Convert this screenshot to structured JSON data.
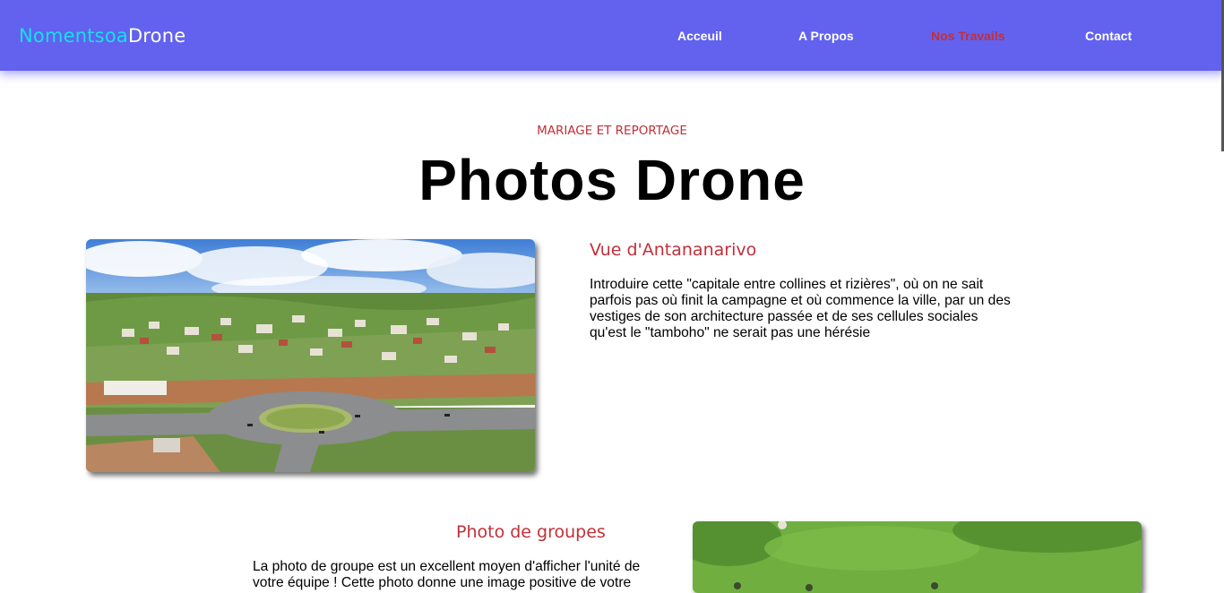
{
  "brand": {
    "part1": "Nomentsoa",
    "part2": "Drone"
  },
  "nav": {
    "items": [
      {
        "label": "Acceuil",
        "active": false
      },
      {
        "label": "A Propos",
        "active": false
      },
      {
        "label": "Nos Travails",
        "active": true
      },
      {
        "label": "Contact",
        "active": false
      }
    ]
  },
  "hero": {
    "kicker": "MARIAGE ET REPORTAGE",
    "title": "Photos Drone"
  },
  "sections": [
    {
      "title": "Vue d'Antananarivo",
      "text": "Introduire cette \"capitale entre collines et rizières\", où on ne sait parfois pas où finit la campagne et où commence la ville, par un des vestiges de son architecture passée et de ses cellules sociales qu'est le \"tamboho\" ne serait pas une hérésie"
    },
    {
      "title": "Photo de groupes",
      "text": "La photo de groupe est un excellent moyen d'afficher l'unité de votre équipe ! Cette photo donne une image positive de votre"
    }
  ],
  "colors": {
    "navbar": "#6262ef",
    "brand_accent": "#16e0e9",
    "accent_red": "#c0303a"
  }
}
